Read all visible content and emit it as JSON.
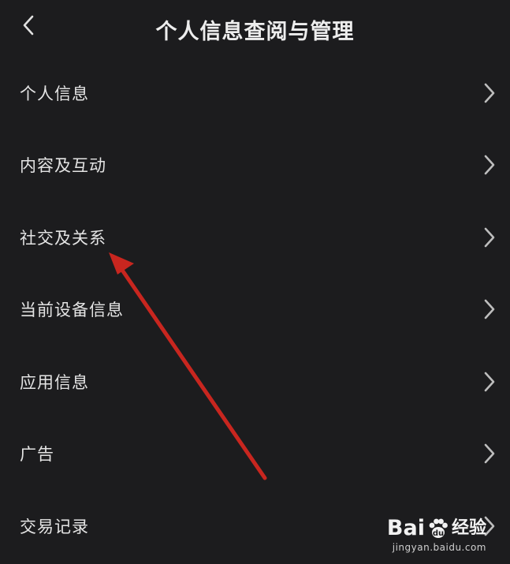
{
  "header": {
    "title": "个人信息查阅与管理",
    "back_icon": "chevron-left-icon"
  },
  "menu": {
    "items": [
      {
        "label": "个人信息",
        "icon": "chevron-right-icon"
      },
      {
        "label": "内容及互动",
        "icon": "chevron-right-icon"
      },
      {
        "label": "社交及关系",
        "icon": "chevron-right-icon"
      },
      {
        "label": "当前设备信息",
        "icon": "chevron-right-icon"
      },
      {
        "label": "应用信息",
        "icon": "chevron-right-icon"
      },
      {
        "label": "广告",
        "icon": "chevron-right-icon"
      },
      {
        "label": "交易记录",
        "icon": "chevron-right-icon"
      }
    ]
  },
  "annotation": {
    "arrow_color": "#c8261f"
  },
  "watermark": {
    "brand": "Bai",
    "brand_suffix": "经验",
    "url": "jingyan.baidu.com"
  },
  "colors": {
    "background": "#1c1c1e",
    "text": "#e4e4e4",
    "chevron": "#bdbdbd"
  }
}
